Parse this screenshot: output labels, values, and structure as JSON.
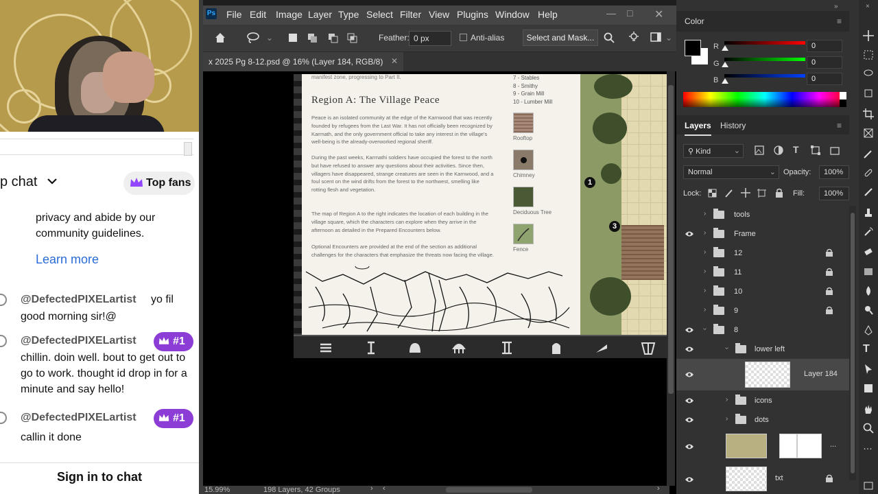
{
  "chat": {
    "header_title": "p chat",
    "top_fans_label": "Top fans",
    "notice_text": "privacy and abide by our community guidelines.",
    "learn_more": "Learn more",
    "messages": [
      {
        "user": "@DefectedPIXELartist",
        "inline": "yo fil",
        "text": "good morning sir!@",
        "badge": ""
      },
      {
        "user": "@DefectedPIXELartist",
        "inline": "",
        "text": "chillin. doin well. bout to get out to go to work. thought id drop in for a minute and say hello!",
        "badge": "#1"
      },
      {
        "user": "@DefectedPIXELartist",
        "inline": "",
        "text": "callin it done",
        "badge": "#1"
      }
    ],
    "sign_in": "Sign in to chat"
  },
  "photoshop": {
    "logo": "Ps",
    "menu": [
      "File",
      "Edit",
      "Image",
      "Layer",
      "Type",
      "Select",
      "Filter",
      "View",
      "Plugins",
      "Window",
      "Help"
    ],
    "options": {
      "feather_label": "Feather:",
      "feather_value": "0 px",
      "antialias_label": "Anti-alias",
      "select_mask_button": "Select and Mask..."
    },
    "tab_title": "x 2025 Pg  8-12.psd @ 16% (Layer 184, RGB/8)",
    "status": {
      "zoom": "15.99%",
      "info": "198 Layers, 42 Groups"
    }
  },
  "document": {
    "top_text": "manifest zone, progressing to Part II.",
    "heading": "Region A: The Village Peace",
    "paragraphs": [
      "Peace is an isolated community at the edge of the Karnwood that was recently founded by refugees from the Last War. It has not officially been recognized by Karrnath, and the only government official to take any interest in the village's well-being is the already-overworked regional sheriff.",
      "During the past weeks, Karrnathi soldiers have occupied the forest to the north but have refused to answer any questions about their activities. Since then, villagers have disappeared, strange creatures are seen in the Karnwood, and a foul scent on the wind drifts from the forest to the northwest, smelling like rotting flesh and vegetation.",
      "The map of Region A to the right indicates the location of each building in the village square, which the characters can explore when they arrive in the afternoon as detailed in the Prepared Encounters below.",
      "Optional Encounters are provided at the end of the section as additional challenges for the characters that emphasize the threats now facing the village."
    ],
    "list": [
      "7 - Stables",
      "8 - Smithy",
      "9 - Grain Mill",
      "10 - Lumber Mill"
    ],
    "legend": [
      "Rooftop",
      "Chimney",
      "Deciduous Tree",
      "Fence"
    ],
    "map_markers": [
      "1",
      "3"
    ]
  },
  "color_panel": {
    "title": "Color",
    "channels": [
      {
        "name": "R",
        "value": "0",
        "color": "#ff2020"
      },
      {
        "name": "G",
        "value": "0",
        "color": "#20ff20"
      },
      {
        "name": "B",
        "value": "0",
        "color": "#2060ff"
      }
    ]
  },
  "layers_panel": {
    "tabs": [
      "Layers",
      "History"
    ],
    "kind_label": "Kind",
    "blend_mode": "Normal",
    "opacity_label": "Opacity:",
    "opacity_value": "100%",
    "lock_label": "Lock:",
    "fill_label": "Fill:",
    "fill_value": "100%",
    "layers": [
      {
        "name": "tools",
        "visible": false,
        "locked": false
      },
      {
        "name": "Frame",
        "visible": true,
        "locked": false
      },
      {
        "name": "12",
        "visible": false,
        "locked": true
      },
      {
        "name": "11",
        "visible": false,
        "locked": true
      },
      {
        "name": "10",
        "visible": false,
        "locked": true
      },
      {
        "name": "9",
        "visible": false,
        "locked": true
      },
      {
        "name": "8",
        "visible": true,
        "locked": false
      },
      {
        "name": "lower left",
        "visible": true,
        "locked": false
      },
      {
        "name": "Layer 184",
        "visible": true,
        "locked": false
      },
      {
        "name": "icons",
        "visible": true,
        "locked": false
      },
      {
        "name": "dots",
        "visible": true,
        "locked": false
      },
      {
        "name": "txt",
        "visible": true,
        "locked": true
      }
    ],
    "more": "..."
  }
}
